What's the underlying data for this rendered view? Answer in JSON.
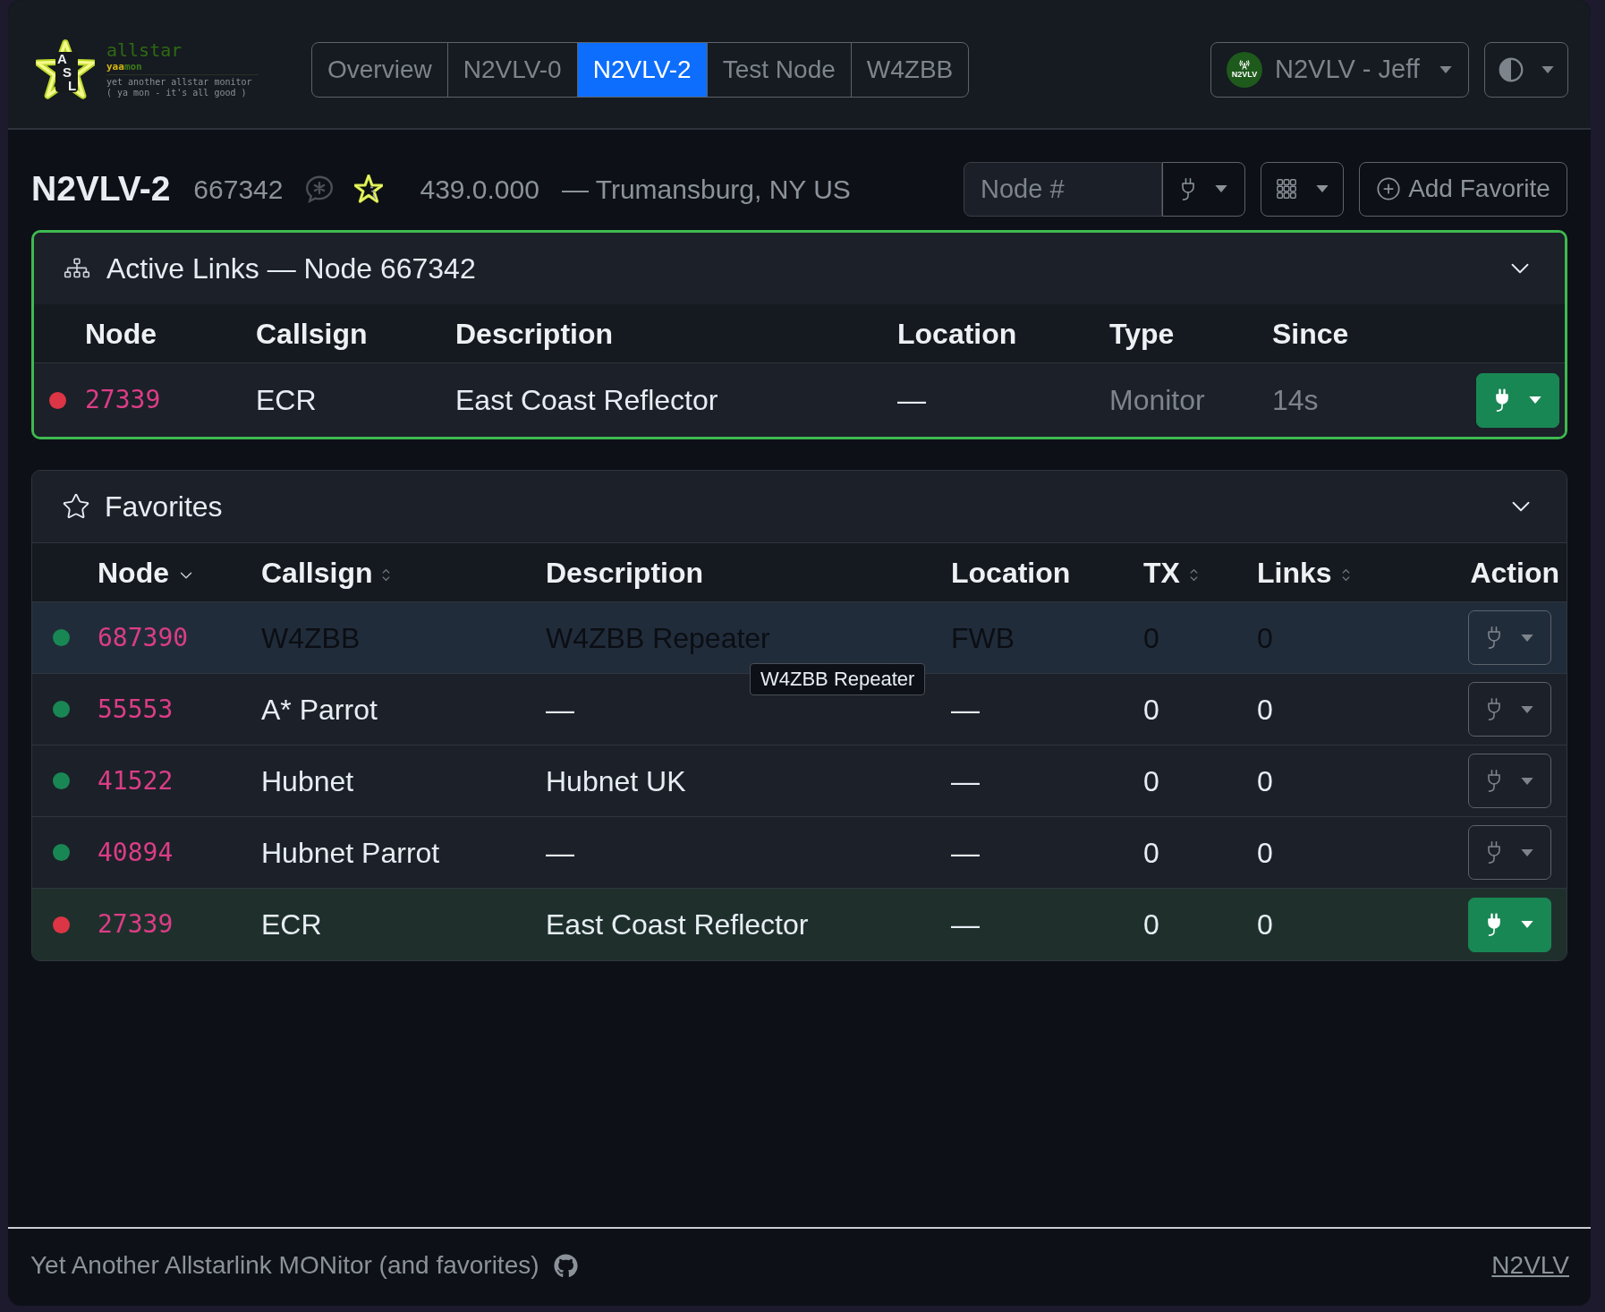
{
  "header": {
    "logo": {
      "badge_letters": [
        "A",
        "S",
        "L"
      ],
      "title": "allstar",
      "wordmark": [
        {
          "text": "yaa",
          "color": "#d6b70c"
        },
        {
          "text": "mon",
          "color": "#3b7d19"
        }
      ],
      "tagline": "yet another allstar monitor",
      "motto": "( ya mon - it's all good )"
    },
    "tabs": [
      {
        "label": "Overview",
        "selected": false
      },
      {
        "label": "N2VLV-0",
        "selected": false
      },
      {
        "label": "N2VLV-2",
        "selected": true
      },
      {
        "label": "Test Node",
        "selected": false
      },
      {
        "label": "W4ZBB",
        "selected": false
      }
    ],
    "user_menu": {
      "avatar_text": "N2VLV",
      "label": "N2VLV - Jeff"
    }
  },
  "node": {
    "title": "N2VLV-2",
    "number": "667342",
    "frequency": "439.0.000",
    "location": "— Trumansburg, NY US"
  },
  "toolbar": {
    "node_input": {
      "placeholder": "Node #"
    },
    "add_favorite": "Add Favorite"
  },
  "active_links": {
    "title": "Active Links — Node 667342",
    "expanded": true,
    "columns": [
      "Node",
      "Callsign",
      "Description",
      "Location",
      "Type",
      "Since"
    ],
    "rows": [
      {
        "color": "#dc3545",
        "node": "27339",
        "callsign": "ECR",
        "description": "East Coast Reflector",
        "location": "—",
        "type": "Monitor",
        "since": "14s",
        "connected": true
      }
    ]
  },
  "favorites": {
    "title": "Favorites",
    "expanded": true,
    "columns": [
      {
        "label": "Node",
        "sortable": true,
        "sorted": true
      },
      {
        "label": "Callsign",
        "sortable": true,
        "sorted": false
      },
      {
        "label": "Description",
        "sortable": false
      },
      {
        "label": "Location",
        "sortable": false
      },
      {
        "label": "TX",
        "sortable": true,
        "sorted": false
      },
      {
        "label": "Links",
        "sortable": true,
        "sorted": false
      },
      {
        "label": "Action",
        "sortable": false
      }
    ],
    "rows": [
      {
        "color": "#198754",
        "node": "687390",
        "callsign": "W4ZBB",
        "description": "W4ZBB Repeater",
        "location": "FWB",
        "tx": "0",
        "links": "0",
        "connected": false,
        "hovered": true,
        "tooltip": "W4ZBB Repeater"
      },
      {
        "color": "#198754",
        "node": "55553",
        "callsign": "A* Parrot",
        "description": "—",
        "location": "—",
        "tx": "0",
        "links": "0",
        "connected": false,
        "hovered": false
      },
      {
        "color": "#198754",
        "node": "41522",
        "callsign": "Hubnet",
        "description": "Hubnet UK",
        "location": "—",
        "tx": "0",
        "links": "0",
        "connected": false,
        "hovered": false
      },
      {
        "color": "#198754",
        "node": "40894",
        "callsign": "Hubnet Parrot",
        "description": "—",
        "location": "—",
        "tx": "0",
        "links": "0",
        "connected": false,
        "hovered": false
      },
      {
        "color": "#dc3545",
        "node": "27339",
        "callsign": "ECR",
        "description": "East Coast Reflector",
        "location": "—",
        "tx": "0",
        "links": "0",
        "connected": true,
        "hovered": false
      }
    ]
  },
  "footer": {
    "text": "Yet Another Allstarlink MONitor (and favorites)",
    "link": "N2VLV"
  }
}
